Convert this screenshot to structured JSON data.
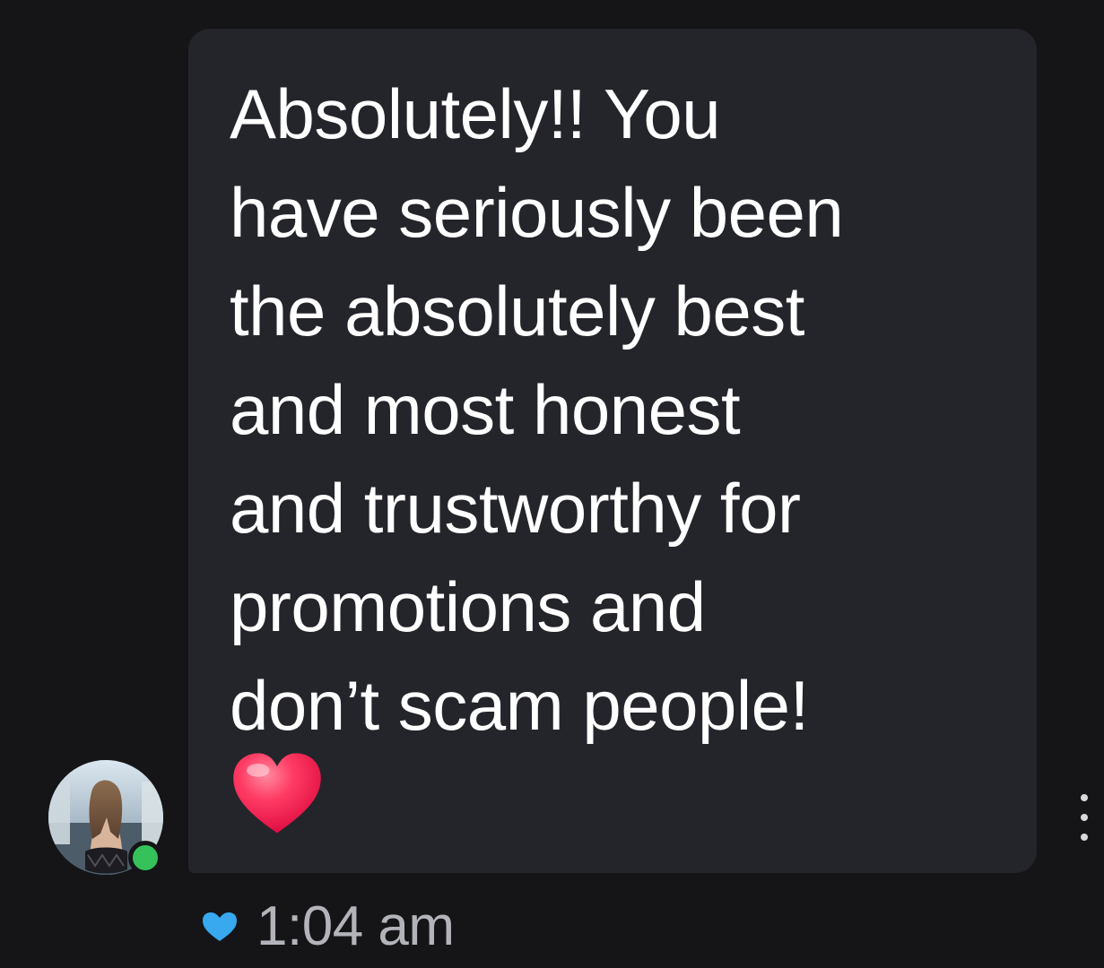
{
  "message": {
    "text": "Absolutely!! You\nhave seriously been\nthe absolutely best\nand most honest\nand trustworthy for\npromotions and\ndon’t scam people!",
    "emoji": "red-heart-icon",
    "background": "#24252b",
    "text_color": "#ffffff"
  },
  "sender": {
    "avatar_icon": "profile-photo",
    "online_status_color": "#35c25a"
  },
  "meta": {
    "liked_icon": "blue-heart-icon",
    "liked_color": "#38a8ef",
    "timestamp": "1:04 am"
  },
  "actions": {
    "more_icon": "three-dot-vertical-icon"
  },
  "theme": {
    "background": "#151518",
    "muted_text": "#b3b4ba"
  }
}
